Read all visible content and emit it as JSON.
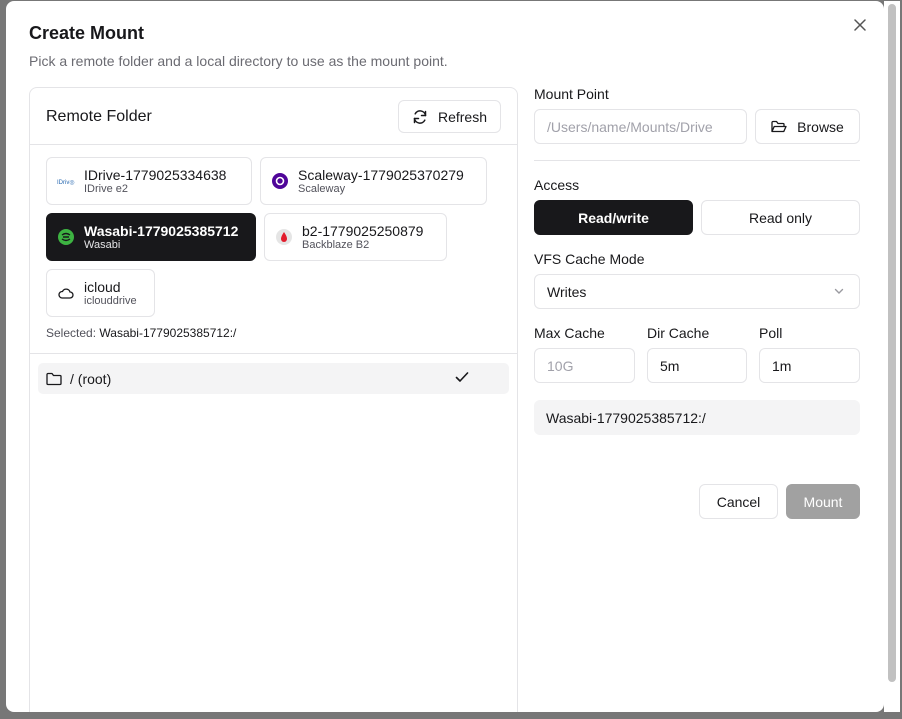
{
  "dialog": {
    "title": "Create Mount",
    "subtitle": "Pick a remote folder and a local directory to use as the mount point."
  },
  "remote": {
    "title": "Remote Folder",
    "refresh_label": "Refresh",
    "remotes": [
      {
        "name": "IDrive-1779025334638",
        "type": "IDrive e2",
        "icon": "idrive-logo-icon"
      },
      {
        "name": "Scaleway-1779025370279",
        "type": "Scaleway",
        "icon": "scaleway-logo-icon"
      },
      {
        "name": "Wasabi-1779025385712",
        "type": "Wasabi",
        "icon": "wasabi-logo-icon",
        "selected": true
      },
      {
        "name": "b2-1779025250879",
        "type": "Backblaze B2",
        "icon": "backblaze-logo-icon"
      },
      {
        "name": "icloud",
        "type": "iclouddrive",
        "icon": "cloud-icon"
      }
    ],
    "selected_prefix": "Selected:",
    "selected_value": "Wasabi-1779025385712:/",
    "folders": [
      {
        "label": "/ (root)",
        "checked": true
      }
    ]
  },
  "mount_point": {
    "label": "Mount Point",
    "placeholder": "/Users/name/Mounts/Drive",
    "value": "",
    "browse_label": "Browse"
  },
  "access": {
    "label": "Access",
    "options": [
      "Read/write",
      "Read only"
    ],
    "selected": "Read/write"
  },
  "vfs_cache": {
    "label": "VFS Cache Mode",
    "value": "Writes"
  },
  "max_cache": {
    "label": "Max Cache",
    "placeholder": "10G",
    "value": ""
  },
  "dir_cache": {
    "label": "Dir Cache",
    "value": "5m"
  },
  "poll": {
    "label": "Poll",
    "value": "1m"
  },
  "path_preview": "Wasabi-1779025385712:/",
  "actions": {
    "cancel_label": "Cancel",
    "mount_label": "Mount"
  },
  "colors": {
    "primary": "#18181b",
    "disabled": "#a1a1a1",
    "border": "#e4e4e7"
  }
}
